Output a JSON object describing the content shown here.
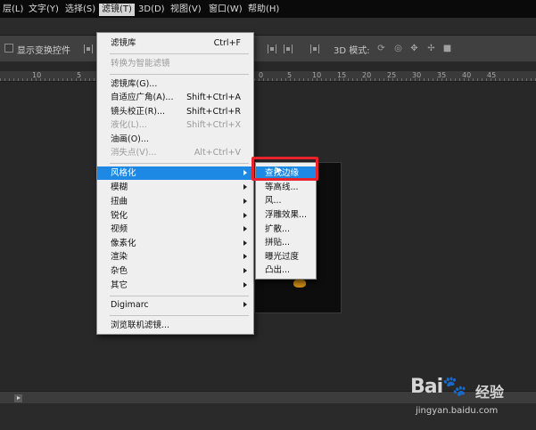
{
  "menubar": {
    "items": [
      "层(L)",
      "文字(Y)",
      "选择(S)",
      "滤镜(T)",
      "3D(D)",
      "视图(V)",
      "窗口(W)",
      "帮助(H)"
    ],
    "active_index": 3
  },
  "optionsbar": {
    "show_transform_label": "显示变换控件",
    "mode_label": "3D 模式:"
  },
  "ruler": {
    "numbers": [
      "10",
      "5",
      "0",
      "5",
      "10",
      "15",
      "20",
      "25",
      "30",
      "35",
      "40",
      "45"
    ]
  },
  "filter_menu": {
    "items": [
      {
        "label": "滤镜库",
        "shortcut": "Ctrl+F",
        "disabled": false
      },
      {
        "label": "转换为智能滤镜",
        "shortcut": "",
        "disabled": true
      },
      {
        "label": "滤镜库(G)...",
        "shortcut": "",
        "disabled": false
      },
      {
        "label": "自适应广角(A)...",
        "shortcut": "Shift+Ctrl+A",
        "disabled": false
      },
      {
        "label": "镜头校正(R)...",
        "shortcut": "Shift+Ctrl+R",
        "disabled": false
      },
      {
        "label": "液化(L)...",
        "shortcut": "Shift+Ctrl+X",
        "disabled": true
      },
      {
        "label": "油画(O)...",
        "shortcut": "",
        "disabled": false
      },
      {
        "label": "消失点(V)...",
        "shortcut": "Alt+Ctrl+V",
        "disabled": true
      },
      {
        "label": "风格化",
        "submenu": true,
        "highlighted": true
      },
      {
        "label": "模糊",
        "submenu": true
      },
      {
        "label": "扭曲",
        "submenu": true
      },
      {
        "label": "锐化",
        "submenu": true
      },
      {
        "label": "视频",
        "submenu": true
      },
      {
        "label": "像素化",
        "submenu": true
      },
      {
        "label": "渲染",
        "submenu": true
      },
      {
        "label": "杂色",
        "submenu": true
      },
      {
        "label": "其它",
        "submenu": true
      },
      {
        "label": "Digimarc",
        "submenu": true
      },
      {
        "label": "浏览联机滤镜..."
      }
    ]
  },
  "stylize_submenu": {
    "items": [
      "查找边缘",
      "等高线...",
      "风...",
      "浮雕效果...",
      "扩散...",
      "拼贴...",
      "曝光过度",
      "凸出..."
    ],
    "highlighted_index": 0
  },
  "watermark": {
    "logo": "Bai",
    "logo_tail": "经验",
    "url": "jingyan.baidu.com"
  },
  "colors": {
    "menu_highlight": "#1e88e5",
    "annotation_box": "#e8232d"
  }
}
